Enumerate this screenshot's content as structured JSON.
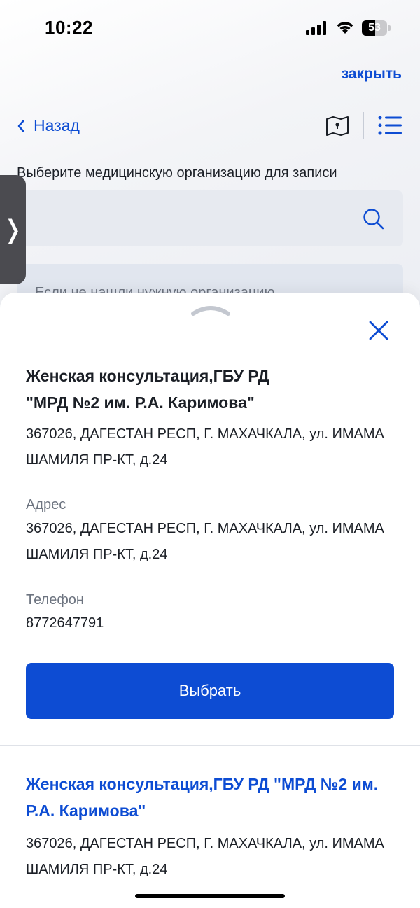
{
  "status_bar": {
    "time": "10:22",
    "battery_level": "53",
    "battery_fraction": 0.53
  },
  "header": {
    "close_label": "закрыть",
    "back_label": "Назад",
    "instruction": "Выберите медицинскую организацию для записи"
  },
  "search": {
    "placeholder": ""
  },
  "info_box": {
    "text": "Если не нашли нужную организацию"
  },
  "sheet": {
    "org": {
      "name_line1": "Женская консультация,ГБУ РД",
      "name_line2": "\"МРД №2 им. Р.А. Каримова\"",
      "address": "367026, ДАГЕСТАН РЕСП, Г. МАХАЧКАЛА, ул. ИМАМА ШАМИЛЯ ПР-КТ, д.24"
    },
    "address_label": "Адрес",
    "address_value": "367026, ДАГЕСТАН РЕСП, Г. МАХАЧКАЛА, ул. ИМАМА ШАМИЛЯ ПР-КТ, д.24",
    "phone_label": "Телефон",
    "phone_value": "8772647791",
    "select_label": "Выбрать"
  },
  "list_item": {
    "title": "Женская консультация,ГБУ РД \"МРД №2 им. Р.А. Каримова\"",
    "address": "367026, ДАГЕСТАН РЕСП, Г. МАХАЧКАЛА, ул. ИМАМА ШАМИЛЯ ПР-КТ, д.24"
  },
  "colors": {
    "accent": "#0d4cd3",
    "text": "#1b1f26",
    "muted": "#6d7480",
    "search_bg": "#e7eaf0"
  },
  "icons": [
    "signal-icon",
    "wifi-icon",
    "battery-icon",
    "chevron-left-icon",
    "map-icon",
    "list-icon",
    "search-icon",
    "chevron-right-icon",
    "drag-handle-icon",
    "close-icon"
  ]
}
